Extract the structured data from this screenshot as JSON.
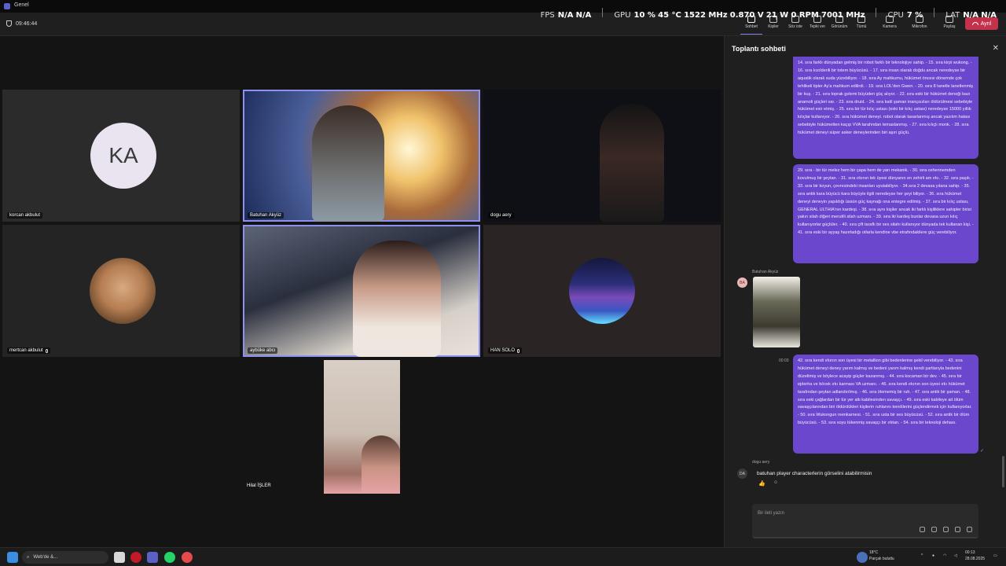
{
  "window": {
    "app_title": "Genel"
  },
  "overlay": {
    "fps_label": "FPS",
    "fps_v1": "N/A",
    "fps_v2": "N/A",
    "gpu_label": "GPU",
    "gpu_load": "10 %",
    "gpu_temp": "45 °C",
    "gpu_clock": "1522 MHz",
    "gpu_voltage": "0.870 V",
    "gpu_power": "21 W",
    "gpu_fan": "0 RPM",
    "gpu_mem": "7001 MHz",
    "cpu_label": "CPU",
    "cpu_load": "7 %",
    "lat_label": "LAT",
    "lat_v1": "N/A",
    "lat_v2": "N/A"
  },
  "topbar": {
    "timer": "09:46:44",
    "buttons": [
      "Sohbet",
      "Kişiler",
      "Söz iste",
      "Tepki ver",
      "Görünüm",
      "Tümü",
      "Kamera",
      "Mikrofon",
      "Paylaş"
    ],
    "people_count": "7",
    "leave": "Ayrıl"
  },
  "participants": {
    "korcan": "korcan akbulut",
    "korcan_initials": "KA",
    "batuhan": "Batuhan Akyüz",
    "dogu": "dogu aery",
    "mertcan": "mertcan akbulut",
    "aybuke": "aybüke abcı",
    "han": "HAN SOLO",
    "hilal": "Hilal İŞLER"
  },
  "chat": {
    "title": "Toplantı sohbeti",
    "msg1": "14. sıra farklı dünyadan gelmiş bir robot farklı bir teknolojiye sahip. - 15. sıra kirpi wukong. - 16. sıra kızılderili bir totem büyücüsü. - 17. sıra insan olarak doğdu ancak neredeyse bir aquatik olarak suda yüzebiliyor. - 18. sıra Ay mahkumu, hükümet öncesi dönemde çok tehlikeli tipler Ay'a mahkum edilirdi. - 19. sıra LOL'den Gwen. - 20. sıra 8 tanetle lanetlenmiş bir kuş. - 21. sıra toprak golemi büyüden güç alıyor. - 22. sıra eski bir hükümet deneği bazı anamoli güçleri var. - 23. sıra druid. - 24. sıra katil şaman inançsızları öldürülmesi sebebiyle hükümet esir etmiş. - 25. sıra bir tür kılıç ustası (eski bir kılıç ustası) neredeyse 15000 yıllık kılıçlar kullanıyor. - 26. sıra hükümet deneyi. robot olarak tasarlanmış ancak yazılım hatası sebebiyle hükümetten kaçıp VVA tarafından temaslanmış. - 27. sıra kılıçlı monk. - 28. sıra hükümet deneyi süper asker deneylerinden biri aşırı güçlü.",
    "msg2": "29. sıra - bir tür melez hem bir çapa hem de yarı mekanik. - 30. sıra cehennemden kovulmuş bir şeytan. - 31. sıra ırkının tek üyesi dünyanın en zehirli am ırkı. - 32. sıra paşık. - 33. sıra bir koyun, çevresindeki insanları uyutabiliyor. - 34.sıra 2 devasa yılana sahip. - 35. sıra antik kara büyücü kara büyüyle ilgili neredeyse her şeyi biliyor. - 36. sıra hükümet deneyi deneyin yapıldığı üssün güç kaynağı ona entegre edilmiş. - 37. sıra bir kılıç ustası, GENERAL ULTHIA'nın kardeşi. - 38. sıra aynı kişiler ancak iki farklı kişiliklere sahipler birisi yakın silah diğeri menzilli silah uzmanı. - 39. sıra iki kardeş bunlar devasa uzun kılıç kullanıyorlar güçlüler. - 40. sıra çift taraflı bir ses silahı kullanıyor dünyada tek kullanan kişi. - 41. sıra eski bir ayyaş hazırladığı otlarla kendine vbe etrafındakilere güç verebiliyor.",
    "batuhan_sender": "Batuhan Akyüz",
    "batuhan_initials": "BA",
    "time_sent": "00:03",
    "msg3": "42. sıra kendi ırkının son üyesi bir metallion gibi bedenlerine şekil verebiliyor. - 43. sıra hükümet deneyi deney yarım kalmış ve bedeni yarım kalmış kendi şartlarıyla bedenini düzeltmiş ve böylece acayip güçler kazanmış. - 44. sıra kocaman bir dev. - 45. sıra bir ejderha ve böcek ırkı karması VA uzmanı. - 46. sıra kendi ırkının son üyesi ırkı hükümet tarafından şeytan adlandırılmış. - 46. sıra ölememiş bir ruh. - 47. sıra antik bir şaman. - 48. sıra eski çağlardan bir tür yer altı kabilesinden savaşçı. - 49. sıra eski kabileye ait ölüm savaşçılarından biri öldürdükleri kişilerin ruhlarını kendilerini güçlendirmek için kullanıyorlar. - 50. sıra Wukongun reenkarnesi. - 51. sıra usta bir ses büyücüsü. - 52. sıra antik bir ölüm büyücüsü. - 53. sıra soyu tükenmiş savaşçı bir ırktan. - 54. sıra bir teknoloji dehası.",
    "dogu_sender": "dogu aery",
    "dogu_initials": "DA",
    "dogu_msg": "batuhan player characterlerin görselini atabilirmisin",
    "reaction": "👍",
    "compose_placeholder": "Bir ileti yazın"
  },
  "taskbar": {
    "search_label": "Web'de &...",
    "weather_temp": "18°C",
    "weather_text": "Parçalı bulutlu",
    "clock_time": "00:13",
    "clock_date": "28.08.2025"
  },
  "colors": {
    "accent": "#6a47cc",
    "speaking_outline": "#8f91f0",
    "leave": "#c4314b"
  }
}
